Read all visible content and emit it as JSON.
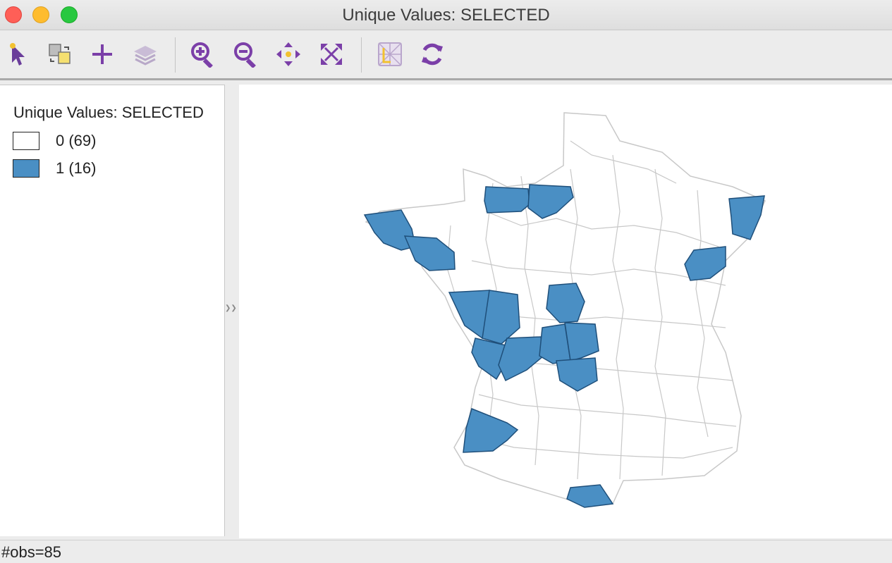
{
  "window": {
    "title": "Unique Values: SELECTED"
  },
  "toolbar": {
    "tools": [
      {
        "name": "select-pointer-icon"
      },
      {
        "name": "swap-selection-icon"
      },
      {
        "name": "add-layer-plus-icon"
      },
      {
        "name": "layers-icon"
      },
      {
        "name": "zoom-in-icon"
      },
      {
        "name": "zoom-out-icon"
      },
      {
        "name": "pan-icon"
      },
      {
        "name": "full-extent-icon"
      },
      {
        "name": "basemap-icon"
      },
      {
        "name": "refresh-icon"
      }
    ],
    "accent_color": "#7b3fa8"
  },
  "legend": {
    "title": "Unique Values: SELECTED",
    "items": [
      {
        "label": "0 (69)",
        "color": "#ffffff"
      },
      {
        "label": "1 (16)",
        "color": "#4a8fc4"
      }
    ]
  },
  "map": {
    "selected_fill": "#4a8fc4",
    "unselected_fill": "#ffffff",
    "boundary_color": "#c8c8c8",
    "selected_outline": "#1f4f7a"
  },
  "status": {
    "text": "#obs=85"
  }
}
